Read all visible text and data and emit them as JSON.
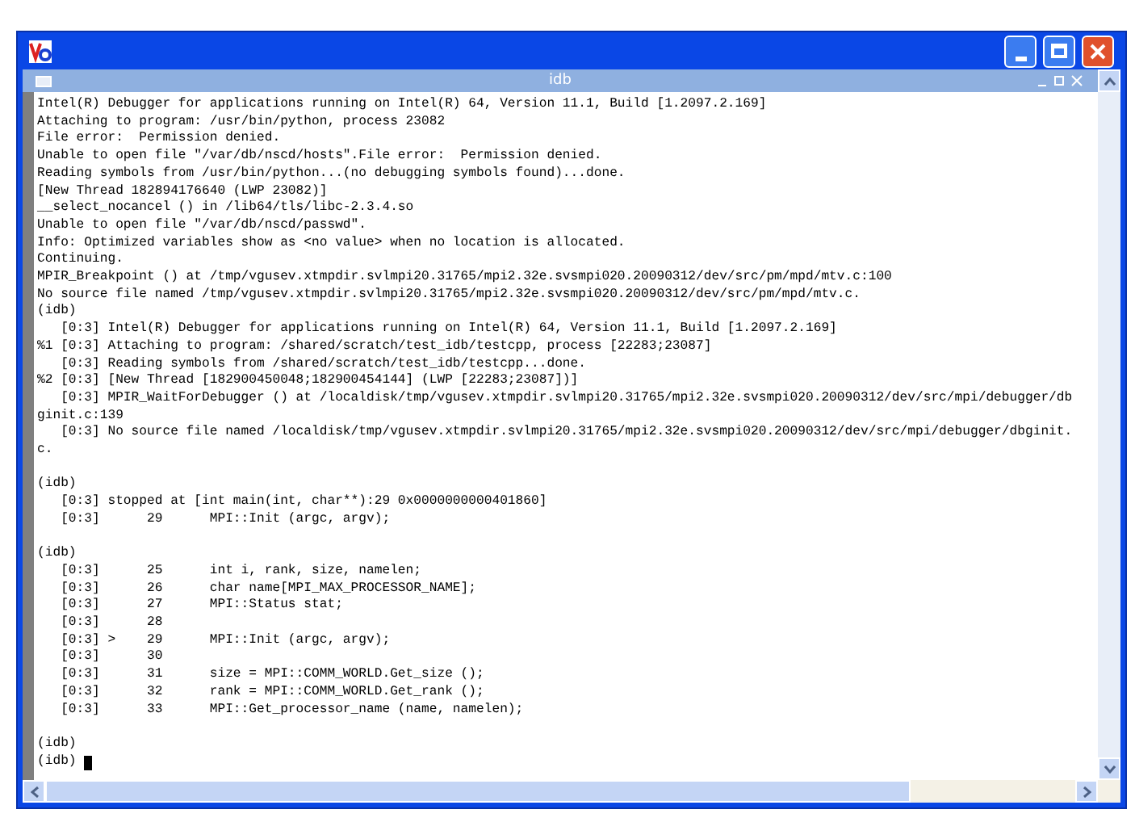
{
  "inner_window": {
    "title": "idb"
  },
  "console": {
    "lines": [
      {
        "text": "Intel(R) Debugger for applications running on Intel(R) 64, Version 11.1, Build [1.2097.2.169]"
      },
      {
        "text": "Attaching to program: /usr/bin/python, process 23082"
      },
      {
        "text": "File error:  Permission denied."
      },
      {
        "text": "Unable to open file \"/var/db/nscd/hosts\".File error:  Permission denied."
      },
      {
        "text": "Reading symbols from /usr/bin/python...(no debugging symbols found)...done."
      },
      {
        "text": "[New Thread 182894176640 (LWP 23082)]"
      },
      {
        "text": "__select_nocancel () in /lib64/tls/libc-2.3.4.so"
      },
      {
        "text": "Unable to open file \"/var/db/nscd/passwd\"."
      },
      {
        "text": "Info: Optimized variables show as <no value> when no location is allocated."
      },
      {
        "text": "Continuing."
      },
      {
        "text": "MPIR_Breakpoint () at /tmp/vgusev.xtmpdir.svlmpi20.31765/mpi2.32e.svsmpi020.20090312/dev/src/pm/mpd/mtv.c:100"
      },
      {
        "text": "No source file named /tmp/vgusev.xtmpdir.svlmpi20.31765/mpi2.32e.svsmpi020.20090312/dev/src/pm/mpd/mtv.c."
      },
      {
        "text": "(idb)"
      },
      {
        "text": "   [0:3] Intel(R) Debugger for applications running on Intel(R) 64, Version 11.1, Build [1.2097.2.169]"
      },
      {
        "text": "%1 [0:3] Attaching to program: /shared/scratch/test_idb/testcpp, process [22283;23087]"
      },
      {
        "text": "   [0:3] Reading symbols from /shared/scratch/test_idb/testcpp...done."
      },
      {
        "text": "%2 [0:3] [New Thread [182900450048;182900454144] (LWP [22283;23087])]"
      },
      {
        "text": "   [0:3] MPIR_WaitForDebugger () at /localdisk/tmp/vgusev.xtmpdir.svlmpi20.31765/mpi2.32e.svsmpi020.20090312/dev/src/mpi/debugger/db"
      },
      {
        "text": "ginit.c:139"
      },
      {
        "text": "   [0:3] No source file named /localdisk/tmp/vgusev.xtmpdir.svlmpi20.31765/mpi2.32e.svsmpi020.20090312/dev/src/mpi/debugger/dbginit."
      },
      {
        "text": "c."
      },
      {
        "text": "(idb)",
        "blank_before": true
      },
      {
        "text": "   [0:3] stopped at [int main(int, char**):29 0x0000000000401860]"
      },
      {
        "text": "   [0:3]      29      MPI::Init (argc, argv);"
      },
      {
        "text": "(idb)",
        "blank_before": true
      },
      {
        "text": "   [0:3]      25      int i, rank, size, namelen;"
      },
      {
        "text": "   [0:3]      26      char name[MPI_MAX_PROCESSOR_NAME];"
      },
      {
        "text": "   [0:3]      27      MPI::Status stat;"
      },
      {
        "text": "   [0:3]      28"
      },
      {
        "text": "   [0:3] >    29      MPI::Init (argc, argv);"
      },
      {
        "text": "   [0:3]      30"
      },
      {
        "text": "   [0:3]      31      size = MPI::COMM_WORLD.Get_size ();"
      },
      {
        "text": "   [0:3]      32      rank = MPI::COMM_WORLD.Get_rank ();"
      },
      {
        "text": "   [0:3]      33      MPI::Get_processor_name (name, namelen);"
      },
      {
        "text": "(idb)",
        "blank_before": true
      },
      {
        "text": "(idb) ",
        "cursor": true
      }
    ]
  }
}
